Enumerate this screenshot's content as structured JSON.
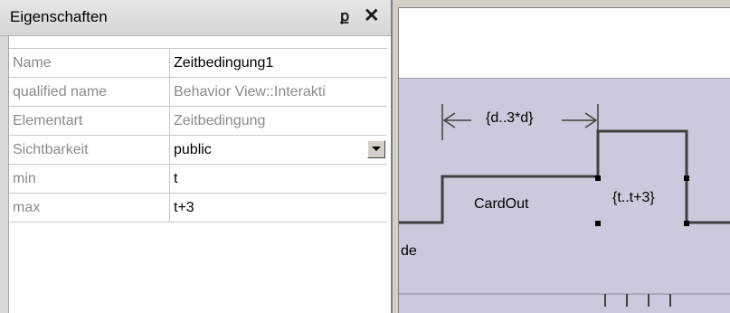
{
  "panel": {
    "title": "Eigenschaften",
    "pin_glyph": "ք",
    "close_glyph": "✕",
    "rows": [
      {
        "name": "Name",
        "value": "Zeitbedingung1",
        "editable": true
      },
      {
        "name": "qualified name",
        "value": "Behavior View::Interakti",
        "editable": false
      },
      {
        "name": "Elementart",
        "value": "Zeitbedingung",
        "editable": false
      },
      {
        "name": "Sichtbarkeit",
        "value": "public",
        "editable": true,
        "dropdown": true
      },
      {
        "name": "min",
        "value": "t",
        "editable": true
      },
      {
        "name": "max",
        "value": "t+3",
        "editable": true
      }
    ]
  },
  "diagram": {
    "duration_label": "{d..3*d}",
    "state_label": "CardOut",
    "time_constraint_label": "{t..t+3}",
    "partial_label": "de"
  }
}
